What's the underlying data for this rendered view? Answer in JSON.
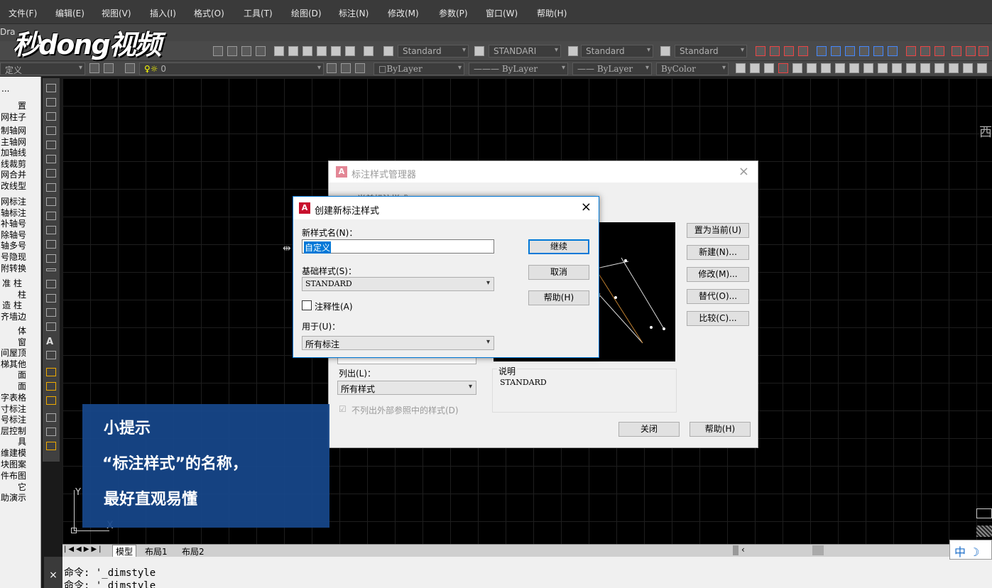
{
  "menu": [
    "文件(F)",
    "编辑(E)",
    "视图(V)",
    "插入(I)",
    "格式(O)",
    "工具(T)",
    "绘图(D)",
    "标注(N)",
    "修改(M)",
    "参数(P)",
    "窗口(W)",
    "帮助(H)"
  ],
  "watermark": "秒dong视频",
  "tab_partial": "Dra",
  "toolbar": {
    "text_style": "Standard",
    "dim_style": "STANDARI",
    "table_style": "Standard",
    "multileader_style": "Standard",
    "workspace": "定义",
    "layer": "0",
    "color": "ByLayer",
    "linetype": "ByLayer",
    "lineweight": "ByLayer",
    "plotstyle": "ByColor"
  },
  "left_panel": {
    "header": "...",
    "items": [
      "置",
      "网柱子",
      "制轴网",
      "主轴网",
      "加轴线",
      "线裁剪",
      "网合并",
      "改线型",
      "网标注",
      "轴标注",
      "补轴号",
      "除轴号",
      "轴多号",
      "号隐现",
      "附转换",
      "准 柱",
      "柱",
      "造 柱",
      "齐墙边",
      "体",
      "窗",
      "间屋顶",
      "梯其他",
      "面",
      "面",
      "字表格",
      "寸标注",
      "号标注",
      "层控制",
      "具",
      "维建模",
      "块图案",
      "件布图",
      "它",
      "助演示"
    ]
  },
  "canvas": {
    "right_edge_char": "西",
    "ucs_y": "Y",
    "ucs_x": "X"
  },
  "layout_tabs": [
    "模型",
    "布局1",
    "布局2"
  ],
  "command_lines": [
    "命令: '_dimstyle",
    "命令: '_dimstyle"
  ],
  "manager": {
    "title": "标注样式管理器",
    "current_label_partial": "当前标注样式",
    "buttons": {
      "set_current": "置为当前(U)",
      "new": "新建(N)...",
      "modify": "修改(M)...",
      "override": "替代(O)...",
      "compare": "比较(C)...",
      "close": "关闭",
      "help": "帮助(H)"
    },
    "list_label": "列出(L)：",
    "list_value": "所有样式",
    "exclude_xref": "不列出外部参照中的样式(D)",
    "desc_label": "说明",
    "desc_value": "STANDARD"
  },
  "new_dialog": {
    "title": "创建新标注样式",
    "name_label": "新样式名(N)：",
    "name_value": "自定义",
    "base_label": "基础样式(S)：",
    "base_value": "STANDARD",
    "annotative": "注释性(A)",
    "for_label": "用于(U)：",
    "for_value": "所有标注",
    "continue": "继续",
    "cancel": "取消",
    "help": "帮助(H)"
  },
  "tip": {
    "title": "小提示",
    "line1": "“标注样式”的名称，",
    "line2": "最好直观易懂"
  },
  "ime": {
    "lang": "中",
    "moon": "☽"
  }
}
